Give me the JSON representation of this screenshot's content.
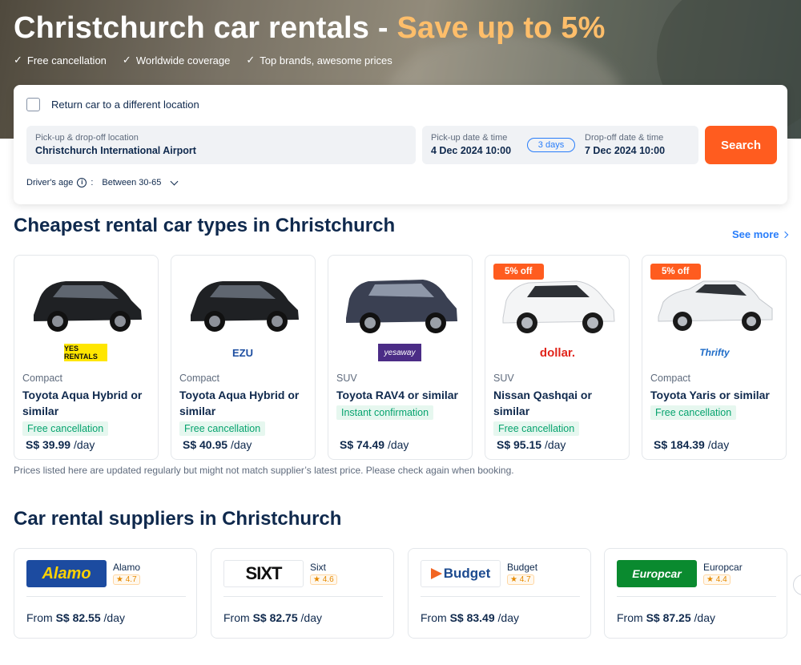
{
  "hero": {
    "title": "Christchurch car rentals - ",
    "title_highlight": "Save up to 5%",
    "benefits": [
      "Free cancellation",
      "Worldwide coverage",
      "Top brands, awesome prices"
    ]
  },
  "search": {
    "return_label": "Return car to a different location",
    "location_label": "Pick-up & drop-off location",
    "location_value": "Christchurch International Airport",
    "pickup_label": "Pick-up date & time",
    "pickup_value": "4 Dec 2024 10:00",
    "duration": "3 days",
    "dropoff_label": "Drop-off date & time",
    "dropoff_value": "7 Dec 2024 10:00",
    "search_button": "Search",
    "age_label": "Driver's age",
    "age_sep": ":",
    "age_value": "Between 30-65"
  },
  "cheapest": {
    "title": "Cheapest rental car types in Christchurch",
    "see_more": "See more",
    "cars": [
      {
        "type": "Compact",
        "name": "Toyota Aqua Hybrid or similar",
        "tag": "Free cancellation",
        "price": "S$ 39.99",
        "per": "/day",
        "supplier": "YES RENTALS",
        "badge": ""
      },
      {
        "type": "Compact",
        "name": "Toyota Aqua Hybrid or similar",
        "tag": "Free cancellation",
        "price": "S$ 40.95",
        "per": "/day",
        "supplier": "EZU",
        "badge": ""
      },
      {
        "type": "SUV",
        "name": "Toyota RAV4 or similar",
        "tag": "Instant confirmation",
        "price": "S$ 74.49",
        "per": "/day",
        "supplier": "yesaway",
        "badge": ""
      },
      {
        "type": "SUV",
        "name": "Nissan Qashqai or similar",
        "tag": "Free cancellation",
        "price": "S$ 95.15",
        "per": "/day",
        "supplier": "dollar.",
        "badge": "5% off"
      },
      {
        "type": "Compact",
        "name": "Toyota Yaris or similar",
        "tag": "Free cancellation",
        "price": "S$ 184.39",
        "per": "/day",
        "supplier": "Thrifty",
        "badge": "5% off"
      }
    ],
    "disclaimer": "Prices listed here are updated regularly but might not match supplier’s latest price. Please check again when booking."
  },
  "suppliers": {
    "title": "Car rental suppliers in Christchurch",
    "items": [
      {
        "name": "Alamo",
        "logo": "Alamo",
        "rating": "★ 4.7",
        "from": "From",
        "price": "S$ 82.55",
        "per": "/day"
      },
      {
        "name": "Sixt",
        "logo": "SIXT",
        "rating": "★ 4.6",
        "from": "From",
        "price": "S$ 82.75",
        "per": "/day"
      },
      {
        "name": "Budget",
        "logo": "Budget",
        "rating": "★ 4.7",
        "from": "From",
        "price": "S$ 83.49",
        "per": "/day"
      },
      {
        "name": "Europcar",
        "logo": "Europcar",
        "rating": "★ 4.4",
        "from": "From",
        "price": "S$ 87.25",
        "per": "/day"
      }
    ]
  },
  "colors": {
    "accent": "#ff5c1f",
    "link": "#287dfa",
    "highlight": "#ffbe6a",
    "tag_green": "#06a36e",
    "text": "#0f294d"
  }
}
